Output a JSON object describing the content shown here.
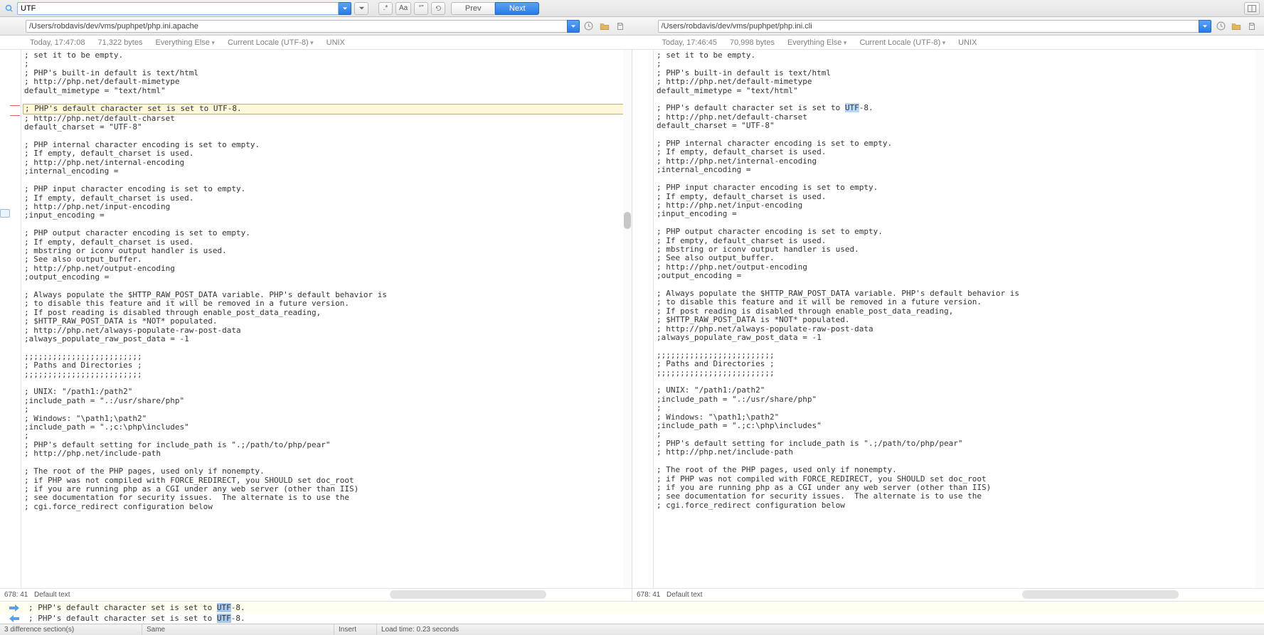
{
  "search": {
    "value": "UTF",
    "prev_label": "Prev",
    "next_label": "Next",
    "regex_label": ".*",
    "case_label": "Aa",
    "word_label": "“”"
  },
  "panes": {
    "left": {
      "path": "/Users/robdavis/dev/vms/puphpet/php.ini.apache",
      "info": {
        "time": "Today, 17:47:08",
        "bytes": "71,322 bytes",
        "filter": "Everything Else",
        "encoding": "Current Locale (UTF-8)",
        "line_endings": "UNIX"
      },
      "code": "; set it to be empty.\n;\n; PHP's built-in default is text/html\n; http://php.net/default-mimetype\ndefault_mimetype = \"text/html\"\n\n|HL|; PHP's default character set is set to UTF-8.\n; http://php.net/default-charset\ndefault_charset = \"UTF-8\"\n\n; PHP internal character encoding is set to empty.\n; If empty, default_charset is used.\n; http://php.net/internal-encoding\n;internal_encoding =\n\n; PHP input character encoding is set to empty.\n; If empty, default_charset is used.\n; http://php.net/input-encoding\n;input_encoding =\n\n; PHP output character encoding is set to empty.\n; If empty, default_charset is used.\n; mbstring or iconv output handler is used.\n; See also output_buffer.\n; http://php.net/output-encoding\n;output_encoding =\n\n; Always populate the $HTTP_RAW_POST_DATA variable. PHP's default behavior is\n; to disable this feature and it will be removed in a future version.\n; If post reading is disabled through enable_post_data_reading,\n; $HTTP_RAW_POST_DATA is *NOT* populated.\n; http://php.net/always-populate-raw-post-data\n;always_populate_raw_post_data = -1\n\n;;;;;;;;;;;;;;;;;;;;;;;;;\n; Paths and Directories ;\n;;;;;;;;;;;;;;;;;;;;;;;;;\n\n; UNIX: \"/path1:/path2\"\n;include_path = \".:/usr/share/php\"\n;\n; Windows: \"\\path1;\\path2\"\n;include_path = \".;c:\\php\\includes\"\n;\n; PHP's default setting for include_path is \".;/path/to/php/pear\"\n; http://php.net/include-path\n\n; The root of the PHP pages, used only if nonempty.\n; if PHP was not compiled with FORCE_REDIRECT, you SHOULD set doc_root\n; if you are running php as a CGI under any web server (other than IIS)\n; see documentation for security issues.  The alternate is to use the\n; cgi.force_redirect configuration below",
      "cursor": "678: 41",
      "default_text": "Default text"
    },
    "right": {
      "path": "/Users/robdavis/dev/vms/puphpet/php.ini.cli",
      "info": {
        "time": "Today, 17:46:45",
        "bytes": "70,998 bytes",
        "filter": "Everything Else",
        "encoding": "Current Locale (UTF-8)",
        "line_endings": "UNIX"
      },
      "code": "; set it to be empty.\n;\n; PHP's built-in default is text/html\n; http://php.net/default-mimetype\ndefault_mimetype = \"text/html\"\n\n; PHP's default character set is set to |HLU|UTF|/HLU|-8.\n; http://php.net/default-charset\ndefault_charset = \"UTF-8\"\n\n; PHP internal character encoding is set to empty.\n; If empty, default_charset is used.\n; http://php.net/internal-encoding\n;internal_encoding =\n\n; PHP input character encoding is set to empty.\n; If empty, default_charset is used.\n; http://php.net/input-encoding\n;input_encoding =\n\n; PHP output character encoding is set to empty.\n; If empty, default_charset is used.\n; mbstring or iconv output handler is used.\n; See also output_buffer.\n; http://php.net/output-encoding\n;output_encoding =\n\n; Always populate the $HTTP_RAW_POST_DATA variable. PHP's default behavior is\n; to disable this feature and it will be removed in a future version.\n; If post reading is disabled through enable_post_data_reading,\n; $HTTP_RAW_POST_DATA is *NOT* populated.\n; http://php.net/always-populate-raw-post-data\n;always_populate_raw_post_data = -1\n\n;;;;;;;;;;;;;;;;;;;;;;;;;\n; Paths and Directories ;\n;;;;;;;;;;;;;;;;;;;;;;;;;\n\n; UNIX: \"/path1:/path2\"\n;include_path = \".:/usr/share/php\"\n;\n; Windows: \"\\path1;\\path2\"\n;include_path = \".;c:\\php\\includes\"\n;\n; PHP's default setting for include_path is \".;/path/to/php/pear\"\n; http://php.net/include-path\n\n; The root of the PHP pages, used only if nonempty.\n; if PHP was not compiled with FORCE_REDIRECT, you SHOULD set doc_root\n; if you are running php as a CGI under any web server (other than IIS)\n; see documentation for security issues.  The alternate is to use the\n; cgi.force_redirect configuration below",
      "cursor": "678: 41",
      "default_text": "Default text"
    }
  },
  "diff_results": {
    "line1": "; PHP's default character set is set to UTF-8.",
    "line2": "; PHP's default character set is set to UTF-8.",
    "hl_token": "UTF"
  },
  "status": {
    "diff_count": "3 difference section(s)",
    "same": "Same",
    "insert": "Insert",
    "load": "Load time: 0.23 seconds"
  }
}
